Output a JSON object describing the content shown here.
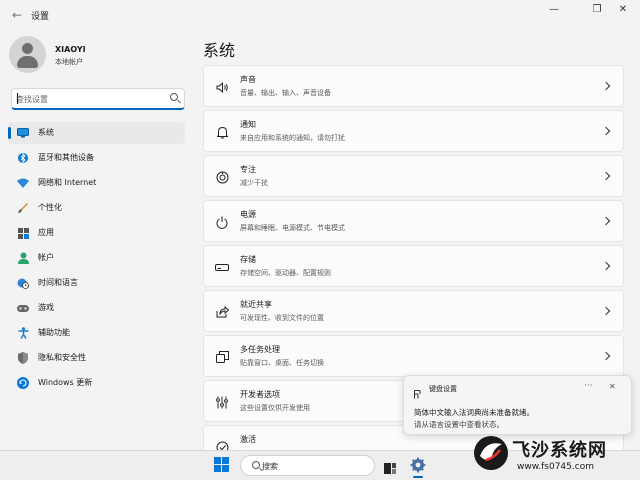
{
  "window": {
    "title": "设置",
    "back_icon": "back-arrow-icon",
    "controls": [
      "minimize-icon",
      "maximize-icon",
      "close-icon"
    ]
  },
  "user": {
    "name": "XIAOYI",
    "account_type": "本地帐户"
  },
  "search": {
    "placeholder": "查找设置"
  },
  "sidebar": {
    "items": [
      {
        "label": "系统",
        "icon": "system-icon",
        "active": true
      },
      {
        "label": "蓝牙和其他设备",
        "icon": "bluetooth-icon",
        "active": false
      },
      {
        "label": "网络和 Internet",
        "icon": "wifi-icon",
        "active": false
      },
      {
        "label": "个性化",
        "icon": "brush-icon",
        "active": false
      },
      {
        "label": "应用",
        "icon": "apps-icon",
        "active": false
      },
      {
        "label": "帐户",
        "icon": "account-icon",
        "active": false
      },
      {
        "label": "时间和语言",
        "icon": "globe-clock-icon",
        "active": false
      },
      {
        "label": "游戏",
        "icon": "gamepad-icon",
        "active": false
      },
      {
        "label": "辅助功能",
        "icon": "accessibility-icon",
        "active": false
      },
      {
        "label": "隐私和安全性",
        "icon": "shield-icon",
        "active": false
      },
      {
        "label": "Windows 更新",
        "icon": "update-icon",
        "active": false
      }
    ]
  },
  "main": {
    "title": "系统",
    "cards": [
      {
        "title": "声音",
        "desc": "音量、输出、输入、声音设备",
        "icon": "speaker-icon"
      },
      {
        "title": "通知",
        "desc": "来自应用和系统的通知，请勿打扰",
        "icon": "bell-icon"
      },
      {
        "title": "专注",
        "desc": "减少干扰",
        "icon": "focus-icon"
      },
      {
        "title": "电源",
        "desc": "屏幕和睡眠、电源模式、节电模式",
        "icon": "power-icon"
      },
      {
        "title": "存储",
        "desc": "存储空间、驱动器、配置规则",
        "icon": "storage-icon"
      },
      {
        "title": "就近共享",
        "desc": "可发现性、收到文件的位置",
        "icon": "share-icon"
      },
      {
        "title": "多任务处理",
        "desc": "贴靠窗口、桌面、任务切换",
        "icon": "multitask-icon"
      },
      {
        "title": "开发者选项",
        "desc": "这些设置仅供开发使用",
        "icon": "developer-icon"
      },
      {
        "title": "激活",
        "desc": "",
        "icon": "activation-icon"
      }
    ]
  },
  "toast": {
    "title": "键盘设置",
    "line1": "简体中文输入法词典尚未准备就绪。",
    "line2": "请从语言设置中查看状态。",
    "icon": "keyboard-icon",
    "more": "···"
  },
  "taskbar": {
    "search_label": "搜索",
    "apps": [
      "start-icon",
      "search-icon",
      "task-view-icon",
      "settings-icon"
    ]
  },
  "watermark": {
    "title": "飞沙系统网",
    "url": "www.fs0745.com"
  },
  "colors": {
    "accent": "#0067c0",
    "background": "#f3f3f3",
    "card": "#fbfbfb"
  }
}
